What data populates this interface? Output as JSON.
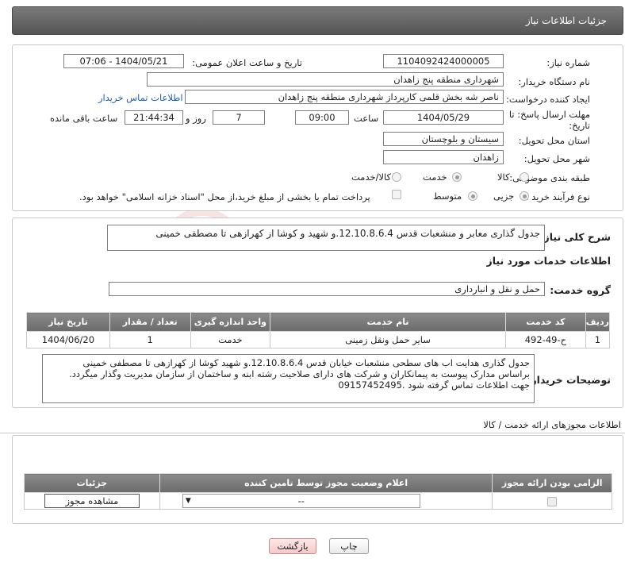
{
  "header": {
    "title": "جزئیات اطلاعات نیاز"
  },
  "form": {
    "need_number_label": "شماره نیاز:",
    "need_number": "1104092424000005",
    "announce_label": "تاریخ و ساعت اعلان عمومی:",
    "announce_value": "1404/05/21 - 07:06",
    "buyer_org_label": "نام دستگاه خریدار:",
    "buyer_org": "شهرداری منطقه پنج زاهدان",
    "creator_label": "ایجاد کننده درخواست:",
    "creator": "ناصر شه بخش قلمی کارپرداز شهرداری منطقه پنج زاهدان",
    "contact_link": "اطلاعات تماس خریدار",
    "deadline_label_1": "مهلت ارسال پاسخ: تا",
    "deadline_label_2": "تاریخ:",
    "deadline_date": "1404/05/29",
    "time_label": "ساعت",
    "deadline_time": "09:00",
    "days_value": "7",
    "days_label": "روز و",
    "remaining_value": "21:44:34",
    "remaining_label": "ساعت باقی مانده",
    "province_label": "استان محل تحویل:",
    "province": "سیستان و بلوچستان",
    "city_label": "شهر محل تحویل:",
    "city": "زاهدان",
    "category_label": "طبقه بندی موضوعی:",
    "category_options": [
      "کالا",
      "خدمت",
      "کالا/خدمت"
    ],
    "category_selected": "خدمت",
    "process_label": "نوع فرآیند خرید :",
    "process_options": [
      "جزیی",
      "متوسط"
    ],
    "process_selected": "جزیی",
    "payment_note": "پرداخت تمام یا بخشی از مبلغ خرید،از محل \"اسناد خزانه اسلامی\" خواهد بود."
  },
  "summary": {
    "label": "شرح کلی نیاز:",
    "text": "جدول گذاری معابر و منشعبات قدس 12.10.8.6.4.و شهید و کوشا از کهرازهی  تا مصطفی خمینی"
  },
  "services": {
    "section_title": "اطلاعات خدمات مورد نیاز",
    "group_label": "گروه خدمت:",
    "group_value": "حمل و نقل و انبارداری",
    "columns": [
      "ردیف",
      "کد خدمت",
      "نام خدمت",
      "واحد اندازه گیری",
      "تعداد / مقدار",
      "تاریخ نیاز"
    ],
    "rows": [
      {
        "index": "1",
        "code": "ح-49-492",
        "name": "سایر حمل ونقل زمینی",
        "unit": "خدمت",
        "qty": "1",
        "date": "1404/06/20"
      }
    ]
  },
  "buyer_notes": {
    "label": "توضیحات خریدار:",
    "line1": "جدول گذاری هدایت اب های سطحی منشعبات خیابان قدس 12.10.8.6.4.و شهید کوشا از کهرازهی تا مصطفی خمینی",
    "line2": "براساس مدارک پیوست به پیمانکاران و شرکت های دارای صلاحیت رشته  ابنه و ساختمان از سازمان مدیریت وگذار میگردد.",
    "line3": "جهت اطلاعات تماس گرفته شود .09157452495"
  },
  "permits": {
    "section_title": "اطلاعات مجوزهای ارائه خدمت / کالا",
    "columns": [
      "الزامی بودن ارائه مجوز",
      "اعلام وضعیت مجوز توسط تامین کننده",
      "جزئیات"
    ],
    "select_value": "--",
    "view_button": "مشاهده مجوز"
  },
  "footer": {
    "print_button": "چاپ",
    "back_button": "بازگشت"
  },
  "watermark": {
    "text": "AriaTender.neT"
  }
}
